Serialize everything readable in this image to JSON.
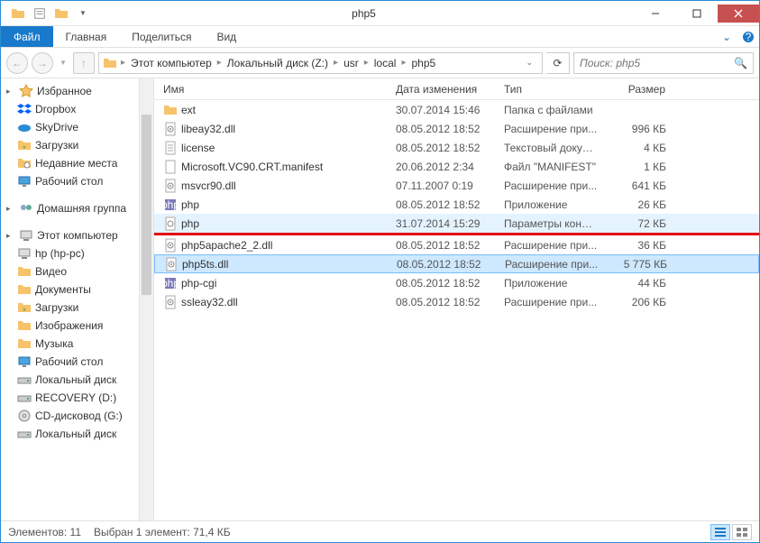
{
  "window": {
    "title": "php5",
    "controls": {
      "minimize": "–",
      "maximize": "❐",
      "close": "✕"
    }
  },
  "ribbon": {
    "tabs": [
      "Файл",
      "Главная",
      "Поделиться",
      "Вид"
    ],
    "active_index": 0
  },
  "address": {
    "crumbs": [
      "Этот компьютер",
      "Локальный диск (Z:)",
      "usr",
      "local",
      "php5"
    ]
  },
  "search": {
    "placeholder": "Поиск: php5"
  },
  "nav": {
    "groups": [
      {
        "header": "Избранное",
        "icon": "star",
        "items": [
          {
            "label": "Dropbox",
            "icon": "dropbox"
          },
          {
            "label": "SkyDrive",
            "icon": "skydrive"
          },
          {
            "label": "Загрузки",
            "icon": "downloads"
          },
          {
            "label": "Недавние места",
            "icon": "recent"
          },
          {
            "label": "Рабочий стол",
            "icon": "desktop"
          }
        ]
      },
      {
        "header": "Домашняя группа",
        "icon": "homegroup",
        "items": []
      },
      {
        "header": "Этот компьютер",
        "icon": "pc",
        "items": [
          {
            "label": "hp (hp-pc)",
            "icon": "pc"
          },
          {
            "label": "Видео",
            "icon": "video"
          },
          {
            "label": "Документы",
            "icon": "docs"
          },
          {
            "label": "Загрузки",
            "icon": "downloads"
          },
          {
            "label": "Изображения",
            "icon": "images"
          },
          {
            "label": "Музыка",
            "icon": "music"
          },
          {
            "label": "Рабочий стол",
            "icon": "desktop"
          },
          {
            "label": "Локальный диск",
            "icon": "drive"
          },
          {
            "label": "RECOVERY (D:)",
            "icon": "drive"
          },
          {
            "label": "CD-дисковод (G:)",
            "icon": "cd"
          },
          {
            "label": "Локальный диск",
            "icon": "drive"
          }
        ]
      }
    ]
  },
  "columns": {
    "name": "Имя",
    "date": "Дата изменения",
    "type": "Тип",
    "size": "Размер"
  },
  "files": [
    {
      "name": "ext",
      "date": "30.07.2014 15:46",
      "type": "Папка с файлами",
      "size": "",
      "icon": "folder"
    },
    {
      "name": "libeay32.dll",
      "date": "08.05.2012 18:52",
      "type": "Расширение при...",
      "size": "996 КБ",
      "icon": "dll"
    },
    {
      "name": "license",
      "date": "08.05.2012 18:52",
      "type": "Текстовый докум...",
      "size": "4 КБ",
      "icon": "txt"
    },
    {
      "name": "Microsoft.VC90.CRT.manifest",
      "date": "20.06.2012 2:34",
      "type": "Файл \"MANIFEST\"",
      "size": "1 КБ",
      "icon": "file"
    },
    {
      "name": "msvcr90.dll",
      "date": "07.11.2007 0:19",
      "type": "Расширение при...",
      "size": "641 КБ",
      "icon": "dll"
    },
    {
      "name": "php",
      "date": "08.05.2012 18:52",
      "type": "Приложение",
      "size": "26 КБ",
      "icon": "php"
    },
    {
      "name": "php",
      "date": "31.07.2014 15:29",
      "type": "Параметры конф...",
      "size": "72 КБ",
      "icon": "ini",
      "highlight": "blue"
    },
    {
      "name": "php5apache2_2.dll",
      "date": "08.05.2012 18:52",
      "type": "Расширение при...",
      "size": "36 КБ",
      "icon": "dll",
      "after_red": true
    },
    {
      "name": "php5ts.dll",
      "date": "08.05.2012 18:52",
      "type": "Расширение при...",
      "size": "5 775 КБ",
      "icon": "dll",
      "selected": true
    },
    {
      "name": "php-cgi",
      "date": "08.05.2012 18:52",
      "type": "Приложение",
      "size": "44 КБ",
      "icon": "php"
    },
    {
      "name": "ssleay32.dll",
      "date": "08.05.2012 18:52",
      "type": "Расширение при...",
      "size": "206 КБ",
      "icon": "dll"
    }
  ],
  "status": {
    "count_label": "Элементов: 11",
    "selection_label": "Выбран 1 элемент: 71,4 КБ"
  }
}
